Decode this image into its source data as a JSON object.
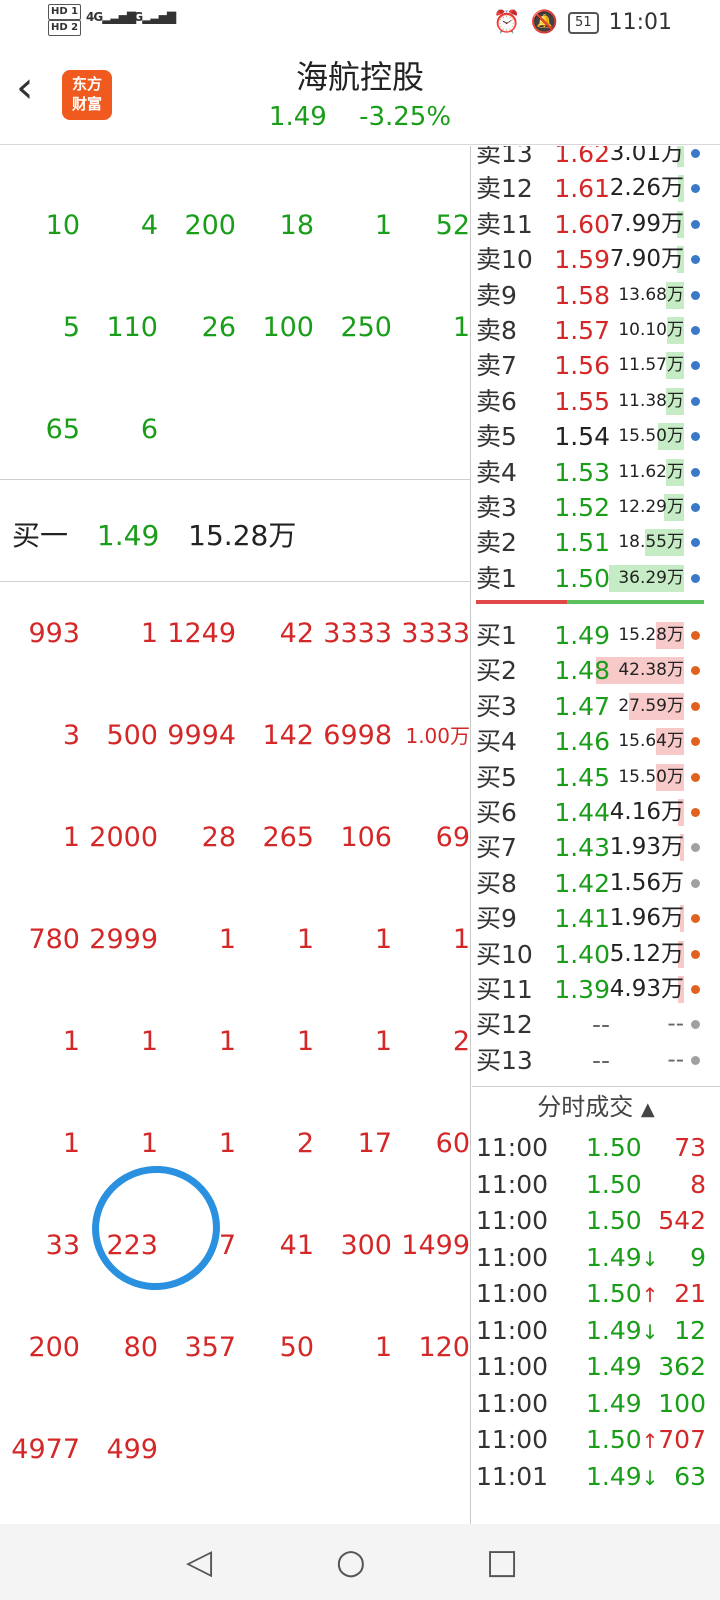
{
  "status": {
    "hd1": "HD 1",
    "hd2": "HD 2",
    "sig1": "4G",
    "sig2": "5G",
    "battery": "51",
    "time": "11:01",
    "icons": [
      "alarm-icon",
      "mute-icon"
    ]
  },
  "header": {
    "title": "海航控股",
    "price": "1.49",
    "change": "-3.25%",
    "logo": [
      "东方",
      "财富"
    ],
    "colors": {
      "up": "#d42828",
      "down": "#1a9e1a",
      "brand": "#f05a1e"
    }
  },
  "sell_grid": [
    [
      "10",
      "4",
      "200",
      "18",
      "1",
      "52"
    ],
    [
      "5",
      "110",
      "26",
      "100",
      "250",
      "1"
    ],
    [
      "65",
      "6"
    ]
  ],
  "buy1": {
    "label": "买一",
    "price": "1.49",
    "volume": "15.28万"
  },
  "buy_grid": [
    [
      "993",
      "1",
      "1249",
      "42",
      "3333",
      "3333"
    ],
    [
      "3",
      "500",
      "9994",
      "142",
      "6998",
      "1.00万"
    ],
    [
      "1",
      "2000",
      "28",
      "265",
      "106",
      "69"
    ],
    [
      "780",
      "2999",
      "1",
      "1",
      "1",
      "1"
    ],
    [
      "1",
      "1",
      "1",
      "1",
      "1",
      "2"
    ],
    [
      "1",
      "1",
      "1",
      "2",
      "17",
      "60"
    ],
    [
      "33",
      "223",
      "7",
      "41",
      "300",
      "1499"
    ],
    [
      "200",
      "80",
      "357",
      "50",
      "1",
      "120"
    ],
    [
      "4977",
      "499"
    ]
  ],
  "asks": [
    {
      "label": "卖13",
      "price": "1.62",
      "vol": "3.01万",
      "fill": 0.08,
      "dot": "blue",
      "color": "red"
    },
    {
      "label": "卖12",
      "price": "1.61",
      "vol": "2.26万",
      "fill": 0.06,
      "dot": "blue",
      "color": "red"
    },
    {
      "label": "卖11",
      "price": "1.60",
      "vol": "7.99万",
      "fill": 0.08,
      "dot": "blue",
      "color": "red"
    },
    {
      "label": "卖10",
      "price": "1.59",
      "vol": "7.90万",
      "fill": 0.08,
      "dot": "blue",
      "color": "red"
    },
    {
      "label": "卖9",
      "price": "1.58",
      "vol": "13.68万",
      "fill": 0.2,
      "dot": "blue",
      "color": "red",
      "small": true
    },
    {
      "label": "卖8",
      "price": "1.57",
      "vol": "10.10万",
      "fill": 0.18,
      "dot": "blue",
      "color": "red",
      "small": true
    },
    {
      "label": "卖7",
      "price": "1.56",
      "vol": "11.57万",
      "fill": 0.2,
      "dot": "blue",
      "color": "red",
      "small": true
    },
    {
      "label": "卖6",
      "price": "1.55",
      "vol": "11.38万",
      "fill": 0.2,
      "dot": "blue",
      "color": "red",
      "small": true
    },
    {
      "label": "卖5",
      "price": "1.54",
      "vol": "15.50万",
      "fill": 0.28,
      "dot": "blue",
      "color": "black",
      "small": true
    },
    {
      "label": "卖4",
      "price": "1.53",
      "vol": "11.62万",
      "fill": 0.2,
      "dot": "blue",
      "color": "green",
      "small": true
    },
    {
      "label": "卖3",
      "price": "1.52",
      "vol": "12.29万",
      "fill": 0.22,
      "dot": "blue",
      "color": "green",
      "small": true
    },
    {
      "label": "卖2",
      "price": "1.51",
      "vol": "18.55万",
      "fill": 0.42,
      "dot": "blue",
      "color": "green",
      "small": true
    },
    {
      "label": "卖1",
      "price": "1.50",
      "vol": "36.29万",
      "fill": 0.82,
      "dot": "blue",
      "color": "green",
      "small": true
    }
  ],
  "bids": [
    {
      "label": "买1",
      "price": "1.49",
      "vol": "15.28万",
      "fill": 0.3,
      "dot": "orange",
      "small": true
    },
    {
      "label": "买2",
      "price": "1.48",
      "vol": "42.38万",
      "fill": 0.96,
      "dot": "orange",
      "small": true
    },
    {
      "label": "买3",
      "price": "1.47",
      "vol": "27.59万",
      "fill": 0.6,
      "dot": "orange",
      "small": true
    },
    {
      "label": "买4",
      "price": "1.46",
      "vol": "15.64万",
      "fill": 0.3,
      "dot": "orange",
      "small": true
    },
    {
      "label": "买5",
      "price": "1.45",
      "vol": "15.50万",
      "fill": 0.3,
      "dot": "orange",
      "small": true
    },
    {
      "label": "买6",
      "price": "1.44",
      "vol": "4.16万",
      "fill": 0.06,
      "dot": "orange"
    },
    {
      "label": "买7",
      "price": "1.43",
      "vol": "1.93万",
      "fill": 0.04,
      "dot": "gray"
    },
    {
      "label": "买8",
      "price": "1.42",
      "vol": "1.56万",
      "fill": 0.0,
      "dot": "gray"
    },
    {
      "label": "买9",
      "price": "1.41",
      "vol": "1.96万",
      "fill": 0.04,
      "dot": "orange"
    },
    {
      "label": "买10",
      "price": "1.40",
      "vol": "5.12万",
      "fill": 0.06,
      "dot": "orange"
    },
    {
      "label": "买11",
      "price": "1.39",
      "vol": "4.93万",
      "fill": 0.06,
      "dot": "orange"
    },
    {
      "label": "买12",
      "price": "--",
      "vol": "--",
      "fill": 0.0,
      "dot": "gray"
    },
    {
      "label": "买13",
      "price": "--",
      "vol": "--",
      "fill": 0.0,
      "dot": "gray"
    }
  ],
  "trades": {
    "header": "分时成交",
    "rows": [
      {
        "time": "11:00",
        "price": "1.50",
        "arrow": "",
        "vol": "73",
        "vcolor": "red"
      },
      {
        "time": "11:00",
        "price": "1.50",
        "arrow": "",
        "vol": "8",
        "vcolor": "red"
      },
      {
        "time": "11:00",
        "price": "1.50",
        "arrow": "",
        "vol": "542",
        "vcolor": "red"
      },
      {
        "time": "11:00",
        "price": "1.49",
        "arrow": "↓",
        "vol": "9",
        "vcolor": "green"
      },
      {
        "time": "11:00",
        "price": "1.50",
        "arrow": "↑",
        "vol": "21",
        "vcolor": "red"
      },
      {
        "time": "11:00",
        "price": "1.49",
        "arrow": "↓",
        "vol": "12",
        "vcolor": "green"
      },
      {
        "time": "11:00",
        "price": "1.49",
        "arrow": "",
        "vol": "362",
        "vcolor": "green"
      },
      {
        "time": "11:00",
        "price": "1.49",
        "arrow": "",
        "vol": "100",
        "vcolor": "green"
      },
      {
        "time": "11:00",
        "price": "1.50",
        "arrow": "↑",
        "vol": "707",
        "vcolor": "red"
      },
      {
        "time": "11:01",
        "price": "1.49",
        "arrow": "↓",
        "vol": "63",
        "vcolor": "green"
      }
    ]
  },
  "nav": {
    "back": "◁",
    "home": "○",
    "recents": "□"
  }
}
